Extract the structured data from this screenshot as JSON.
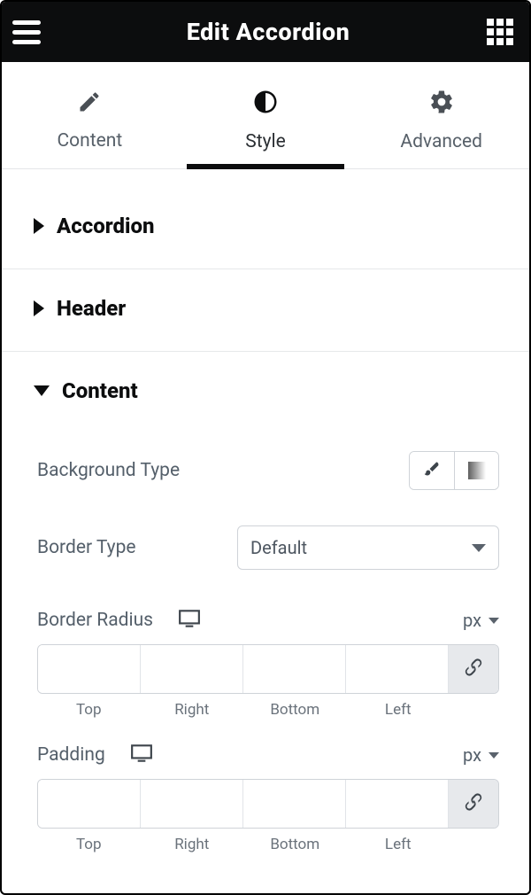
{
  "header": {
    "title": "Edit Accordion"
  },
  "tabs": {
    "content": "Content",
    "style": "Style",
    "advanced": "Advanced"
  },
  "sections": {
    "accordion": "Accordion",
    "header": "Header",
    "content": "Content"
  },
  "content_panel": {
    "background_type_label": "Background Type",
    "border_type_label": "Border Type",
    "border_type_value": "Default",
    "border_radius_label": "Border Radius",
    "border_radius_unit": "px",
    "border_radius_values": {
      "top": "",
      "right": "",
      "bottom": "",
      "left": ""
    },
    "padding_label": "Padding",
    "padding_unit": "px",
    "padding_values": {
      "top": "",
      "right": "",
      "bottom": "",
      "left": ""
    },
    "captions": {
      "top": "Top",
      "right": "Right",
      "bottom": "Bottom",
      "left": "Left"
    }
  }
}
